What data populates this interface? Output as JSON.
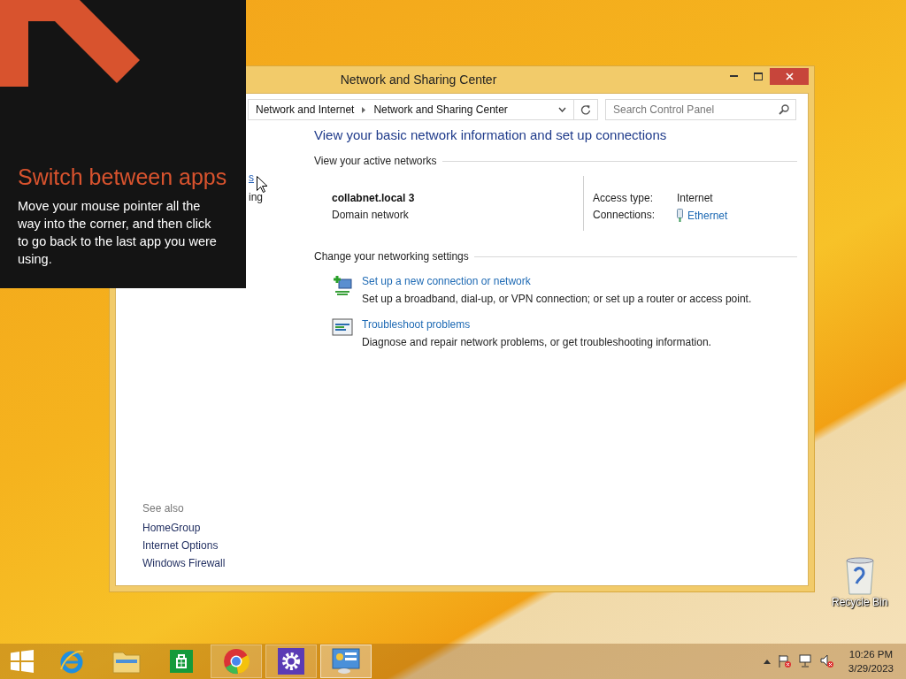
{
  "desktop": {
    "icons": [
      {
        "label": "Recycle Bin"
      }
    ]
  },
  "window": {
    "title": "Network and Sharing Center",
    "breadcrumb": [
      "Network and Internet",
      "Network and Sharing Center"
    ],
    "search": {
      "placeholder": "Search Control Panel"
    },
    "sidebar_fragments": [
      {
        "text": "s",
        "kind": "link"
      },
      {
        "text": "ing",
        "kind": "text"
      }
    ],
    "see_also": {
      "heading": "See also",
      "links": [
        "HomeGroup",
        "Internet Options",
        "Windows Firewall"
      ]
    },
    "heading": "View your basic network information and set up connections",
    "active_networks": {
      "heading": "View your active networks",
      "networks": [
        {
          "name": "collabnet.local 3",
          "category": "Domain network",
          "access_type_label": "Access type:",
          "access_type": "Internet",
          "connections_label": "Connections:",
          "connection": "Ethernet"
        }
      ]
    },
    "settings": {
      "heading": "Change your networking settings",
      "tasks": [
        {
          "kind": "new-connection",
          "title": "Set up a new connection or network",
          "description": "Set up a broadband, dial-up, or VPN connection; or set up a router or access point."
        },
        {
          "kind": "troubleshoot",
          "title": "Troubleshoot problems",
          "description": "Diagnose and repair network problems, or get troubleshooting information."
        }
      ]
    }
  },
  "tip": {
    "title": "Switch between apps",
    "body": "Move your mouse pointer all the way into the corner, and then click to go back to the last app you were using."
  },
  "taskbar": {
    "apps": [
      {
        "kind": "ie",
        "running": false,
        "selected": false
      },
      {
        "kind": "explorer",
        "running": false,
        "selected": false
      },
      {
        "kind": "store",
        "running": false,
        "selected": false
      },
      {
        "kind": "chrome",
        "running": true,
        "selected": false
      },
      {
        "kind": "settings",
        "running": true,
        "selected": false
      },
      {
        "kind": "control-panel",
        "running": true,
        "selected": true
      }
    ],
    "clock": {
      "time": "10:26 PM",
      "date": "3/29/2023"
    }
  }
}
